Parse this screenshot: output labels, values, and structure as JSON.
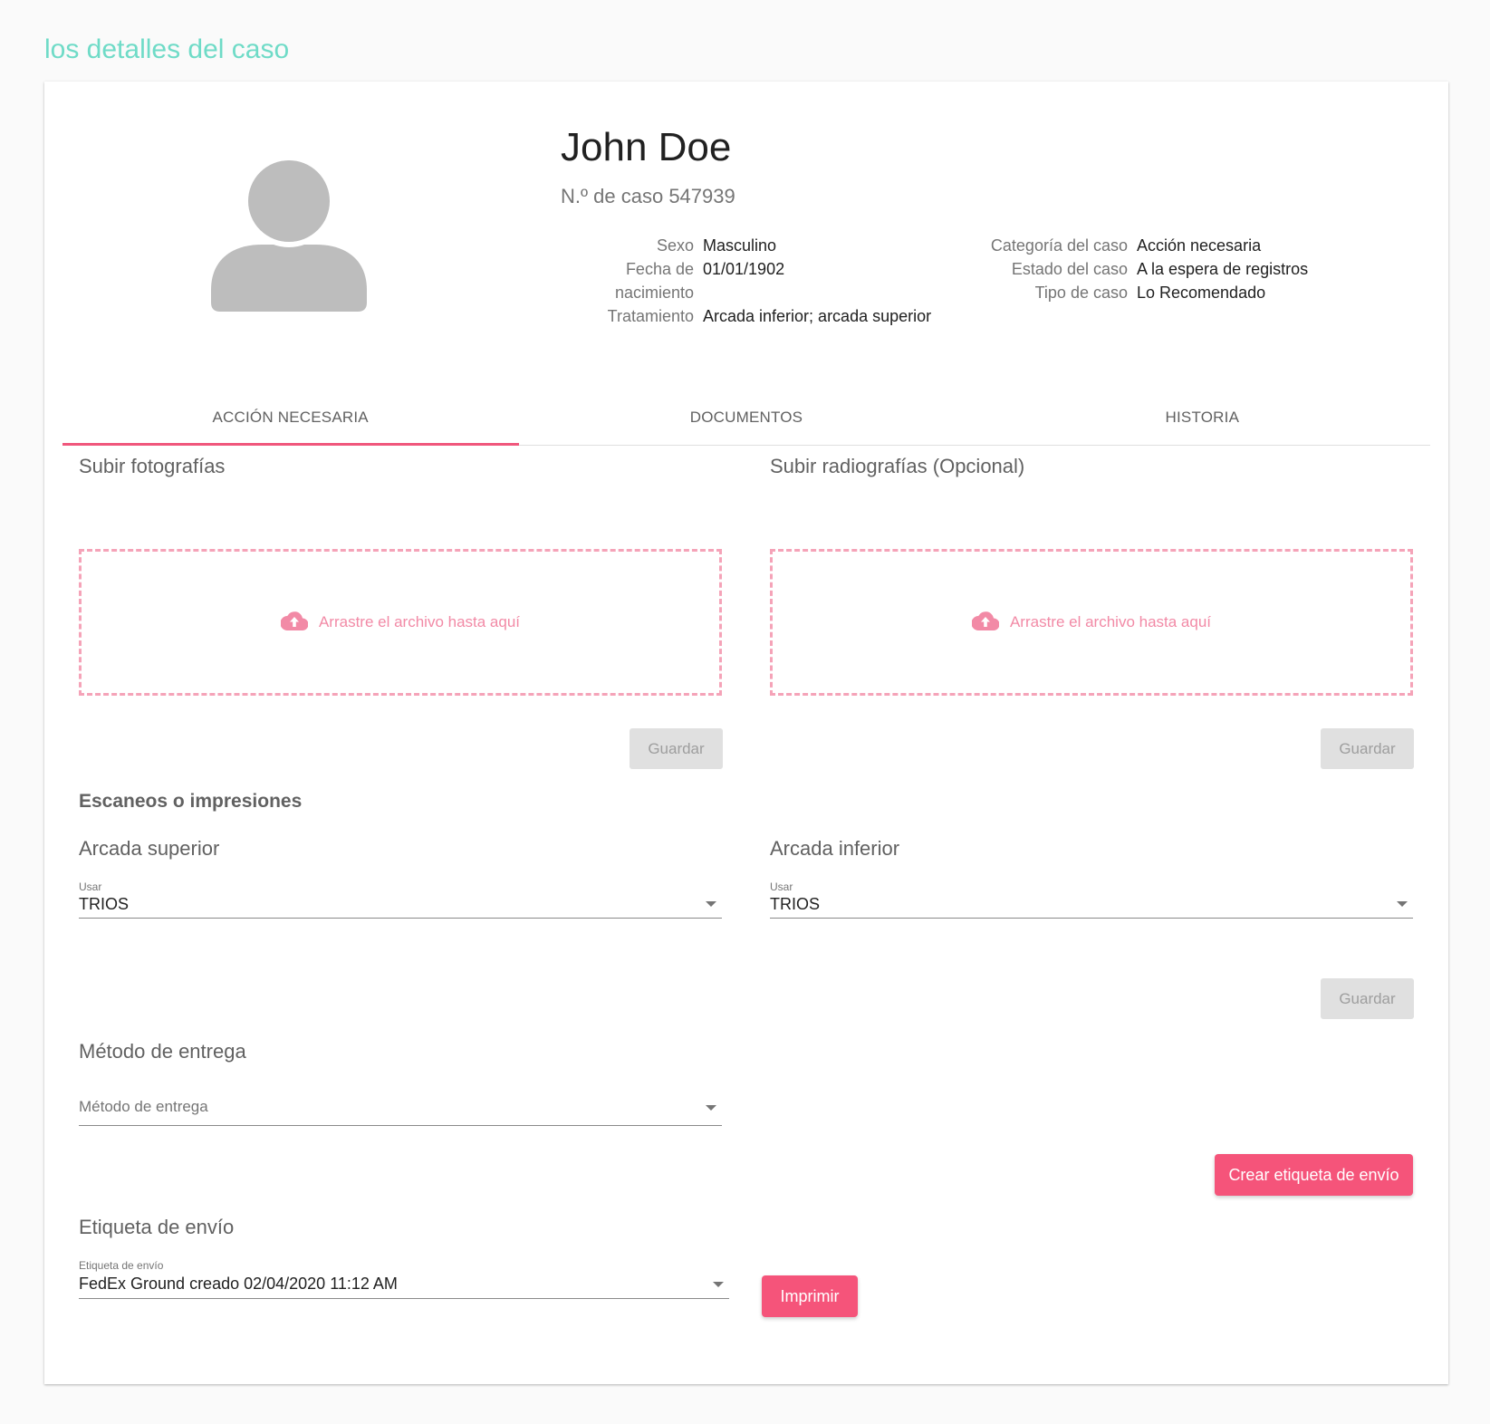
{
  "page": {
    "title": "los detalles del caso"
  },
  "patient": {
    "name": "John Doe",
    "case_number": "N.º de caso 547939",
    "details_left": [
      {
        "label": "Sexo",
        "value": "Masculino"
      },
      {
        "label": "Fecha de nacimiento",
        "value": "01/01/1902"
      },
      {
        "label": "Tratamiento",
        "value": "Arcada inferior; arcada superior"
      }
    ],
    "details_right": [
      {
        "label": "Categoría del caso",
        "value": "Acción necesaria"
      },
      {
        "label": "Estado del caso",
        "value": "A la espera de registros"
      },
      {
        "label": "Tipo de caso",
        "value": "Lo Recomendado"
      }
    ]
  },
  "tabs": [
    {
      "label": "ACCIÓN NECESARIA",
      "active": true
    },
    {
      "label": "DOCUMENTOS",
      "active": false
    },
    {
      "label": "HISTORIA",
      "active": false
    }
  ],
  "photos": {
    "title": "Subir fotografías",
    "dropzone_text": "Arrastre el archivo hasta aquí",
    "save_label": "Guardar"
  },
  "xrays": {
    "title": "Subir radiografías (Opcional)",
    "dropzone_text": "Arrastre el archivo hasta aquí",
    "save_label": "Guardar"
  },
  "scans": {
    "heading": "Escaneos o impresiones",
    "upper": {
      "title": "Arcada superior",
      "field_label": "Usar",
      "value": "TRIOS"
    },
    "lower": {
      "title": "Arcada inferior",
      "field_label": "Usar",
      "value": "TRIOS"
    },
    "save_label": "Guardar"
  },
  "delivery": {
    "title": "Método de entrega",
    "placeholder": "Método de entrega",
    "create_label_button": "Crear etiqueta de envío"
  },
  "shipping": {
    "title": "Etiqueta de envío",
    "field_label": "Etiqueta de envío",
    "value": "FedEx Ground creado 02/04/2020 11:12 AM",
    "print_button": "Imprimir"
  },
  "colors": {
    "accent": "#f5547a",
    "title_teal": "#6fdbc7",
    "dropzone_border": "#f5a3b8"
  },
  "icons": {
    "avatar": "person-silhouette-icon",
    "upload": "cloud-upload-icon",
    "dropdown": "arrow-drop-down-icon"
  }
}
